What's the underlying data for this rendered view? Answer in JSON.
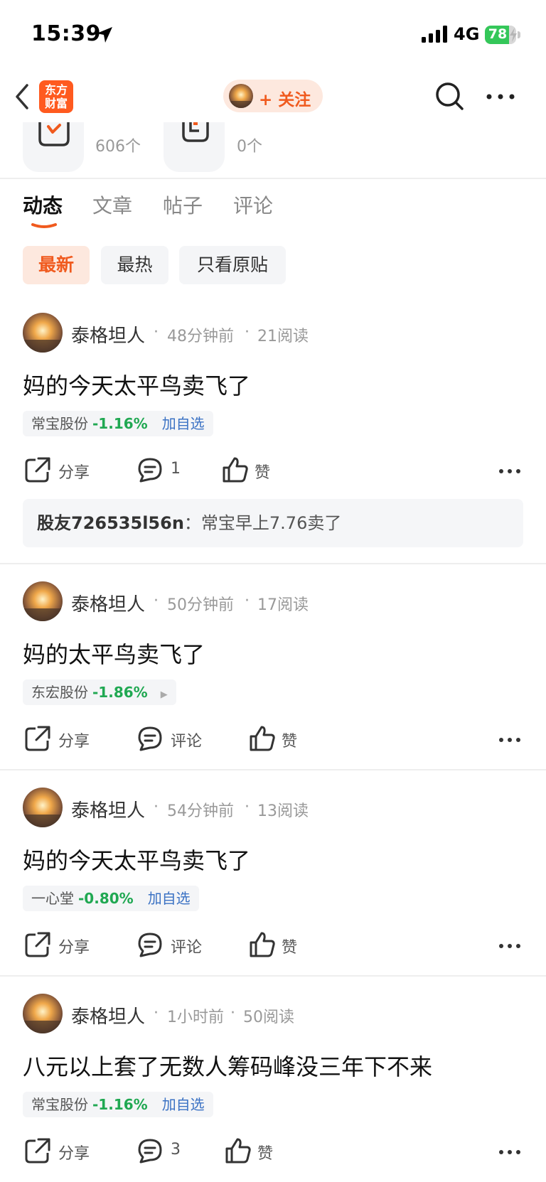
{
  "status_bar": {
    "time": "15:39",
    "network": "4G",
    "battery_level": "78",
    "battery_fraction": 0.78
  },
  "nav": {
    "logo_text_line1": "东方",
    "logo_text_line2": "财富",
    "follow_label": "+ 关注"
  },
  "stats": [
    {
      "count": "606个"
    },
    {
      "count": "0个"
    }
  ],
  "tabs": [
    {
      "label": "动态",
      "active": true
    },
    {
      "label": "文章",
      "active": false
    },
    {
      "label": "帖子",
      "active": false
    },
    {
      "label": "评论",
      "active": false
    }
  ],
  "filters": [
    {
      "label": "最新",
      "active": true
    },
    {
      "label": "最热",
      "active": false
    },
    {
      "label": "只看原贴",
      "active": false
    }
  ],
  "posts": [
    {
      "author": "泰格坦人",
      "time": "48分钟前",
      "reads": "21阅读",
      "text": "妈的今天太平鸟卖飞了",
      "stock_name": "常宝股份",
      "stock_change": "-1.16%",
      "stock_action": "加自选",
      "share_label": "分享",
      "comment_label": "1",
      "like_label": "赞",
      "reply_user": "股友726535l56n",
      "reply_sep": "：",
      "reply_text": "常宝早上7.76卖了"
    },
    {
      "author": "泰格坦人",
      "time": "50分钟前",
      "reads": "17阅读",
      "text": "妈的太平鸟卖飞了",
      "stock_name": "东宏股份",
      "stock_change": "-1.86%",
      "stock_arrow": "▶",
      "share_label": "分享",
      "comment_label": "评论",
      "like_label": "赞"
    },
    {
      "author": "泰格坦人",
      "time": "54分钟前",
      "reads": "13阅读",
      "text": "妈的今天太平鸟卖飞了",
      "stock_name": "一心堂",
      "stock_change": "-0.80%",
      "stock_action": "加自选",
      "share_label": "分享",
      "comment_label": "评论",
      "like_label": "赞"
    },
    {
      "author": "泰格坦人",
      "time": "1小时前",
      "reads": "50阅读",
      "text": "八元以上套了无数人筹码峰没三年下不来",
      "stock_name": "常宝股份",
      "stock_change": "-1.16%",
      "stock_action": "加自选",
      "share_label": "分享",
      "comment_label": "3",
      "like_label": "赞"
    }
  ],
  "meta_dot": "·",
  "colors": {
    "accent": "#f05a1e",
    "stock_down": "#20a852",
    "link_blue": "#3b72c4"
  }
}
